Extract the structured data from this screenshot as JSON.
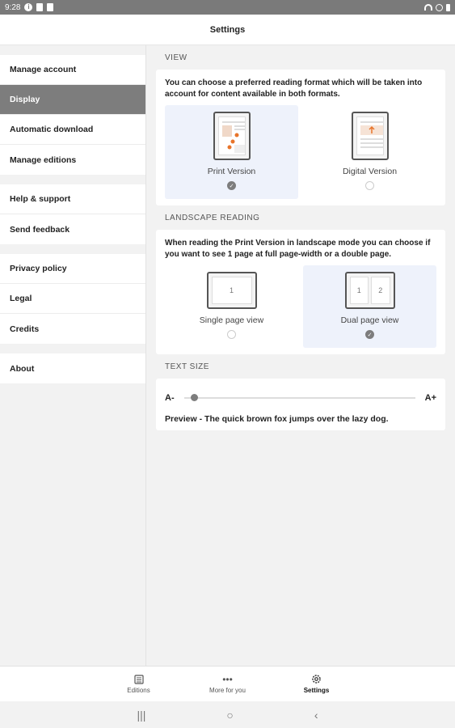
{
  "status": {
    "time": "9:28"
  },
  "header": {
    "title": "Settings"
  },
  "sidebar": {
    "groups": [
      [
        "Manage account",
        "Display",
        "Automatic download",
        "Manage editions"
      ],
      [
        "Help & support",
        "Send feedback"
      ],
      [
        "Privacy policy",
        "Legal",
        "Credits"
      ],
      [
        "About"
      ]
    ],
    "active": "Display"
  },
  "view": {
    "header": "VIEW",
    "description": "You can choose a preferred reading format which will be taken into account for content available in both formats.",
    "options": [
      {
        "label": "Print Version",
        "selected": true
      },
      {
        "label": "Digital Version",
        "selected": false
      }
    ]
  },
  "landscape": {
    "header": "LANDSCAPE READING",
    "description": "When reading the Print Version in landscape mode you can choose if you want to see 1 page at full page-width or a double page.",
    "options": [
      {
        "label": "Single page view",
        "selected": false,
        "pages": [
          "1"
        ]
      },
      {
        "label": "Dual page view",
        "selected": true,
        "pages": [
          "1",
          "2"
        ]
      }
    ]
  },
  "textsize": {
    "header": "TEXT SIZE",
    "min_label": "A-",
    "max_label": "A+",
    "level": 0,
    "preview": "Preview - The quick brown fox jumps over the lazy dog."
  },
  "bottom_nav": [
    {
      "label": "Editions",
      "icon": "editions-icon",
      "active": false
    },
    {
      "label": "More for you",
      "icon": "more-icon",
      "active": false
    },
    {
      "label": "Settings",
      "icon": "settings-gear-icon",
      "active": true
    }
  ],
  "colors": {
    "accent": "#e8742a",
    "selected_bg": "#eef2fb",
    "active_sidebar": "#7d7d7d"
  }
}
